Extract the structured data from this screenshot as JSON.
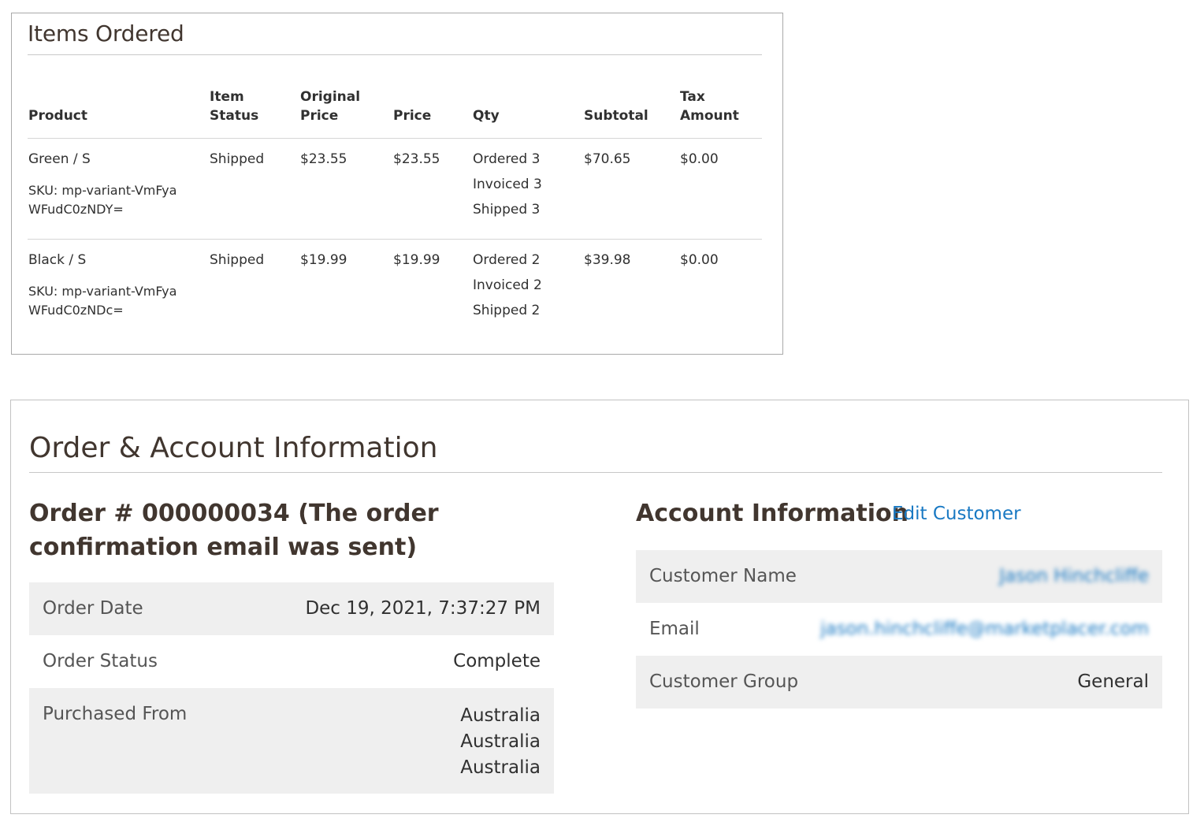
{
  "items_ordered": {
    "title": "Items Ordered",
    "headers": {
      "product": "Product",
      "item_status_1": "Item",
      "item_status_2": "Status",
      "original_price_1": "Original",
      "original_price_2": "Price",
      "price": "Price",
      "qty": "Qty",
      "subtotal": "Subtotal",
      "tax_amount_1": "Tax",
      "tax_amount_2": "Amount"
    },
    "rows": [
      {
        "product": "Green / S",
        "sku": "SKU: mp-variant-VmFyaWFudC0zNDY=",
        "status": "Shipped",
        "original_price": "$23.55",
        "price": "$23.55",
        "qty_ordered": "Ordered 3",
        "qty_invoiced": "Invoiced 3",
        "qty_shipped": "Shipped 3",
        "subtotal": "$70.65",
        "tax": "$0.00"
      },
      {
        "product": "Black / S",
        "sku": "SKU: mp-variant-VmFyaWFudC0zNDc=",
        "status": "Shipped",
        "original_price": "$19.99",
        "price": "$19.99",
        "qty_ordered": "Ordered 2",
        "qty_invoiced": "Invoiced 2",
        "qty_shipped": "Shipped 2",
        "subtotal": "$39.98",
        "tax": "$0.00"
      }
    ]
  },
  "order_account": {
    "title": "Order & Account Information",
    "order_heading": "Order # 000000034 (The order confirmation email was sent)",
    "order_info": {
      "order_date_label": "Order Date",
      "order_date_value": "Dec 19, 2021, 7:37:27 PM",
      "order_status_label": "Order Status",
      "order_status_value": "Complete",
      "purchased_from_label": "Purchased From",
      "purchased_from_values": [
        "Australia",
        "Australia",
        "Australia"
      ]
    },
    "account_heading": "Account Information",
    "edit_customer_link": "Edit Customer",
    "account_info": {
      "customer_name_label": "Customer Name",
      "customer_name_value": "Jason Hinchcliffe",
      "email_label": "Email",
      "email_value": "jason.hinchcliffe@marketplacer.com",
      "customer_group_label": "Customer Group",
      "customer_group_value": "General"
    },
    "colors": {
      "link": "#1979c3",
      "row_shade": "#efefef",
      "heading": "#41362f"
    }
  }
}
